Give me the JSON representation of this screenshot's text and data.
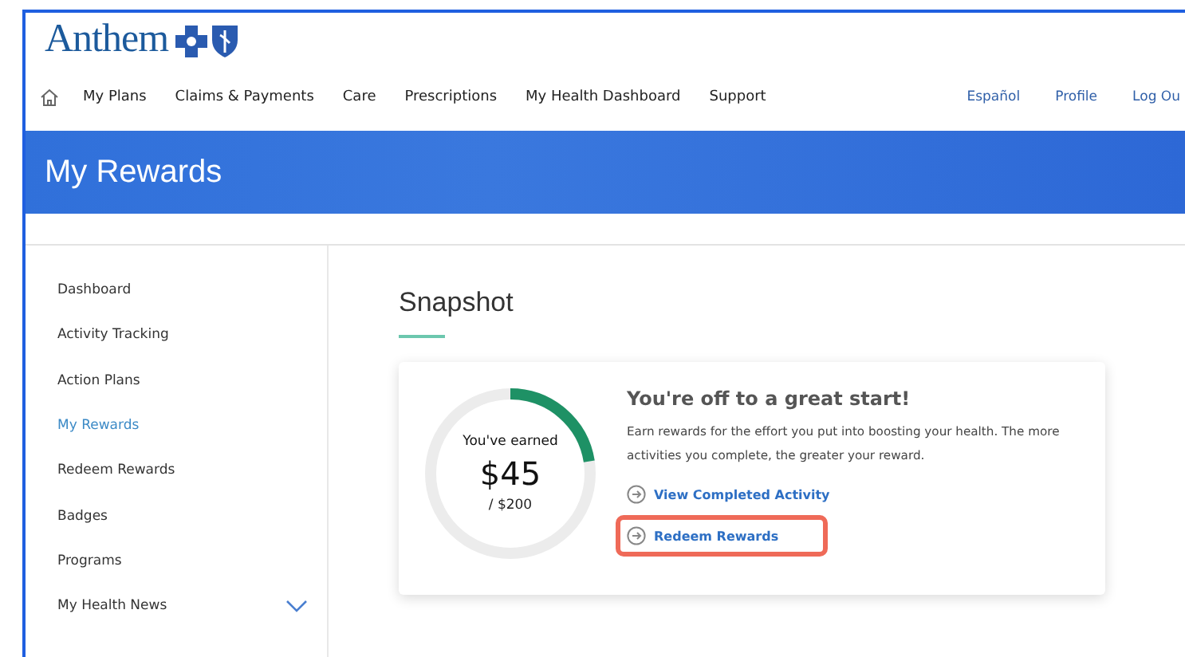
{
  "logo": {
    "text": "Anthem"
  },
  "nav": {
    "items": [
      {
        "label": "My Plans"
      },
      {
        "label": "Claims & Payments"
      },
      {
        "label": "Care"
      },
      {
        "label": "Prescriptions"
      },
      {
        "label": "My Health Dashboard"
      },
      {
        "label": "Support"
      }
    ],
    "utility": [
      {
        "label": "Español"
      },
      {
        "label": "Profile"
      },
      {
        "label": "Log Ou"
      }
    ]
  },
  "banner": {
    "title": "My Rewards"
  },
  "sidebar": {
    "items": [
      {
        "label": "Dashboard",
        "selected": false
      },
      {
        "label": "Activity Tracking",
        "selected": false
      },
      {
        "label": "Action Plans",
        "selected": false
      },
      {
        "label": "My Rewards",
        "selected": true
      },
      {
        "label": "Redeem Rewards",
        "selected": false
      },
      {
        "label": "Badges",
        "selected": false
      },
      {
        "label": "Programs",
        "selected": false
      },
      {
        "label": "My Health News",
        "selected": false,
        "expandable": true
      }
    ]
  },
  "snapshot": {
    "title": "Snapshot",
    "progress": {
      "caption": "You've earned",
      "amount": "$45",
      "total": "/ $200",
      "level": 0.225
    },
    "heading": "You're off to a great start!",
    "text": "Earn rewards for the effort you put into boosting your health. The more activities you complete, the greater your reward.",
    "links": [
      {
        "label": "View Completed Activity",
        "highlighted": false
      },
      {
        "label": "Redeem Rewards",
        "highlighted": true
      }
    ]
  }
}
